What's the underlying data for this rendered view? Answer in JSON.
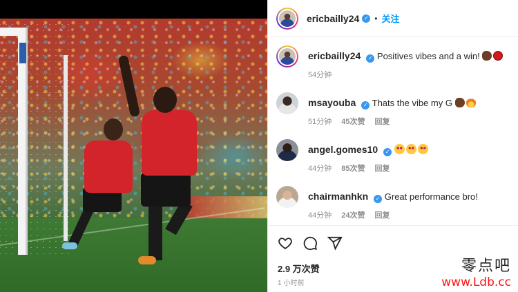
{
  "post_author": {
    "username": "ericbailly24",
    "follow_label": "关注",
    "separator": "•"
  },
  "caption": {
    "username": "ericbailly24",
    "text": "Positives vibes and a win!",
    "emojis": [
      "flexed-biceps-emoji",
      "red-circle-emoji"
    ],
    "time": "54分钟"
  },
  "comments": [
    {
      "username": "msayouba",
      "text": "Thats the vibe my G",
      "emojis": [
        "flexed-biceps-emoji",
        "fire-emoji"
      ],
      "time": "51分钟",
      "likes": "45次赞",
      "reply": "回复"
    },
    {
      "username": "angel.gomes10",
      "text": "",
      "emojis": [
        "star-struck-emoji",
        "star-struck-emoji",
        "star-struck-emoji"
      ],
      "time": "44分钟",
      "likes": "85次赞",
      "reply": "回复"
    },
    {
      "username": "chairmanhkn",
      "text": "Great performance bro!",
      "emojis": [],
      "time": "44分钟",
      "likes": "24次赞",
      "reply": "回复"
    }
  ],
  "footer": {
    "likes": "2.9 万次赞",
    "posted": "1 小时前",
    "icons": [
      "heart-icon",
      "comment-icon",
      "share-icon"
    ]
  },
  "watermark": {
    "site_cn": "零点吧",
    "url": "www.Ldb.cc"
  },
  "colors": {
    "link_blue": "#0095f6",
    "verified_blue": "#3897f0",
    "muted_text": "#8e8e8e",
    "watermark_red": "#ff1111"
  }
}
